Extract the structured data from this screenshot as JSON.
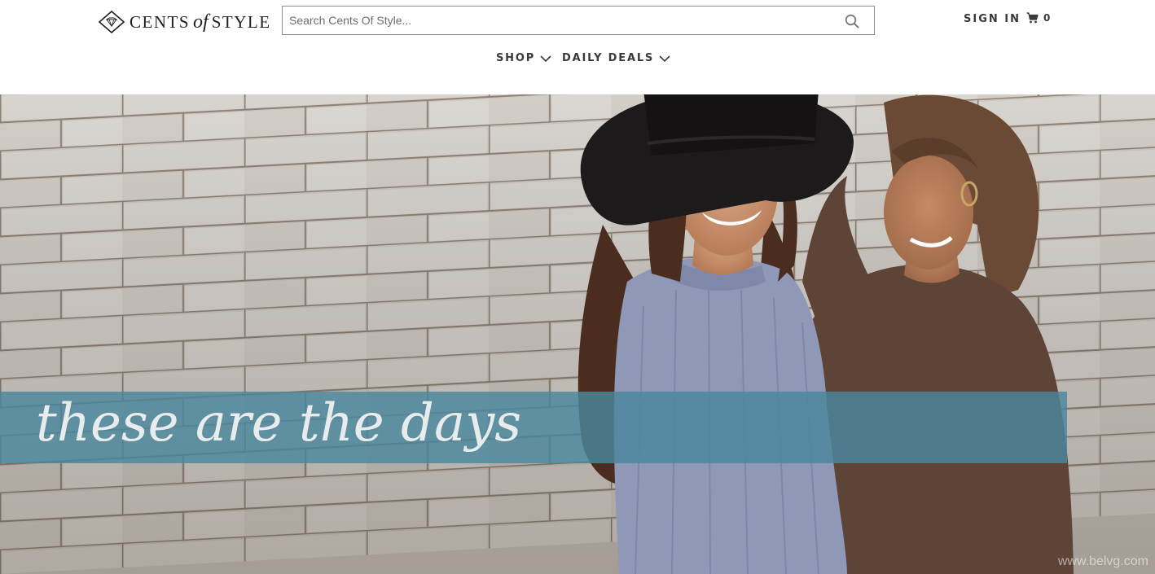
{
  "brand": {
    "logo_text_1": "CENTS",
    "logo_text_2": "of",
    "logo_text_3": "STYLE"
  },
  "search": {
    "placeholder": "Search Cents Of Style...",
    "value": "",
    "icon": "search-icon"
  },
  "account": {
    "sign_in_label": "SIGN IN",
    "cart_icon": "cart-icon",
    "cart_count": "0"
  },
  "nav": {
    "items": [
      {
        "label": "SHOP",
        "icon": "chevron-down-icon"
      },
      {
        "label": "DAILY DEALS",
        "icon": "chevron-down-icon"
      }
    ]
  },
  "hero": {
    "headline": "these are the days",
    "watermark": "www.belvg.com",
    "banner_color": "#4a879e"
  }
}
